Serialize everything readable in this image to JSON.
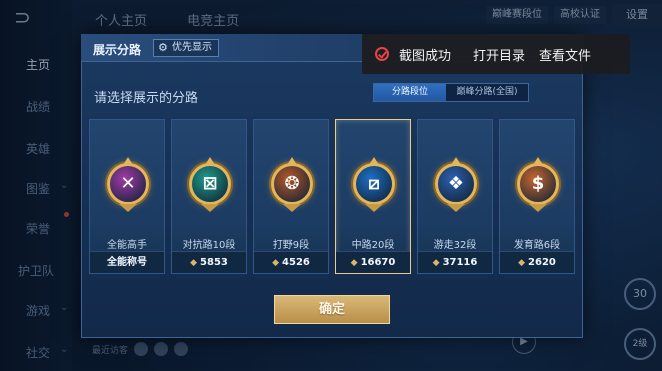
{
  "background": {
    "top_tabs": [
      "个人主页",
      "电竞主页"
    ],
    "top_right": [
      "巅峰赛段位",
      "高校认证",
      "设置"
    ],
    "nav": [
      "主页",
      "战绩",
      "英雄",
      "图鉴",
      "荣誉",
      "护卫队",
      "游戏",
      "社交"
    ],
    "bottom_text": "最近访客",
    "right_deco_1": "30",
    "right_deco_2": "2级"
  },
  "dialog": {
    "title": "展示分路",
    "priority_label": "优先显示",
    "subtitle": "请选择展示的分路",
    "segments": [
      "分路段位",
      "巅峰分路(全国)"
    ],
    "cards": [
      {
        "name": "全能高手",
        "footer": "全能称号",
        "has_diamond": false,
        "badge_color": "#a23aa6",
        "badge_glyph": "✕"
      },
      {
        "name": "对抗路10段",
        "footer": "5853",
        "has_diamond": true,
        "badge_color": "#1f9a8a",
        "badge_glyph": "⊠"
      },
      {
        "name": "打野9段",
        "footer": "4526",
        "has_diamond": true,
        "badge_color": "#b5572a",
        "badge_glyph": "❂"
      },
      {
        "name": "中路20段",
        "footer": "16670",
        "has_diamond": true,
        "badge_color": "#1f6fc4",
        "badge_glyph": "⧄",
        "selected": true
      },
      {
        "name": "游走32段",
        "footer": "37116",
        "has_diamond": true,
        "badge_color": "#2d5fb0",
        "badge_glyph": "❖"
      },
      {
        "name": "发育路6段",
        "footer": "2620",
        "has_diamond": true,
        "badge_color": "#c8662e",
        "badge_glyph": "$"
      }
    ],
    "confirm_label": "确定"
  },
  "toast": {
    "message": "截图成功",
    "open_dir": "打开目录",
    "view_file": "查看文件"
  }
}
